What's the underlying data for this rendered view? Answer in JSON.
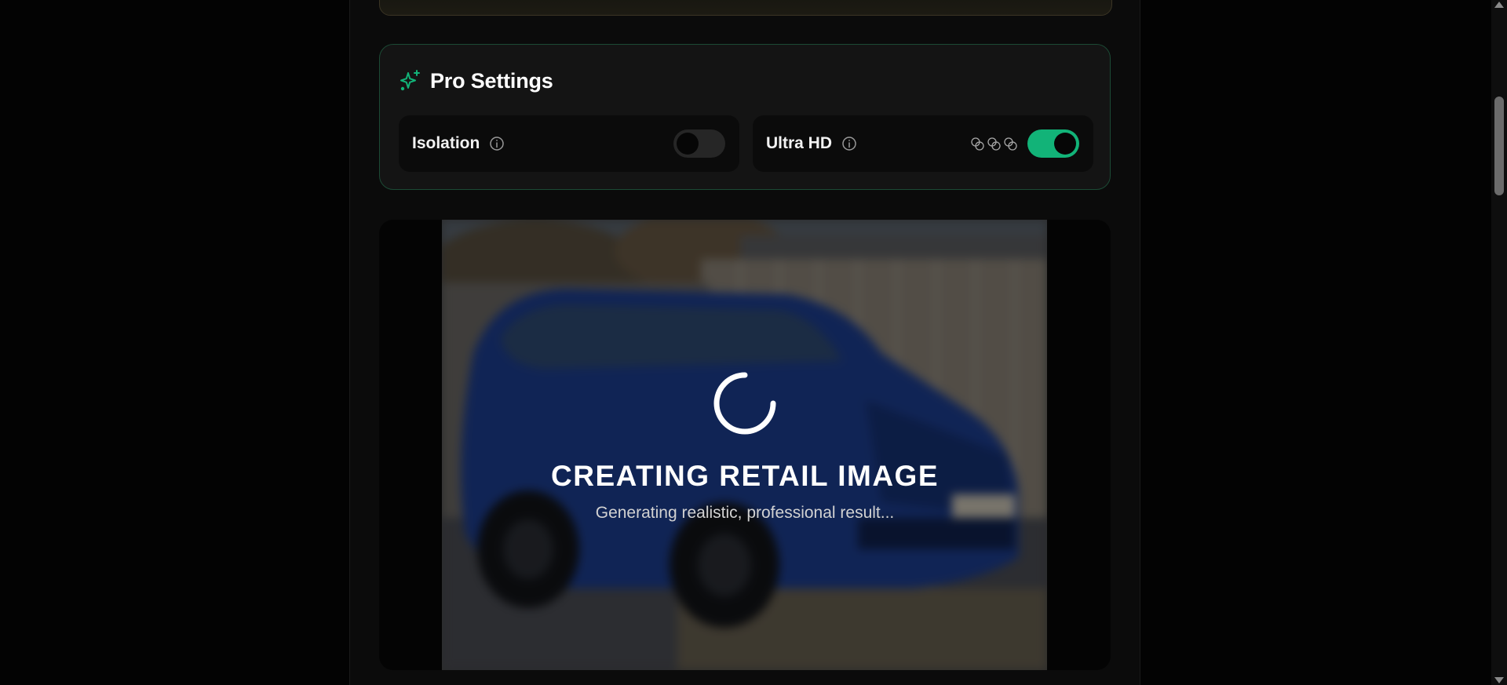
{
  "pro_settings": {
    "title": "Pro Settings",
    "icon": "sparkle-icon",
    "accent_color": "#12b378",
    "isolation": {
      "label": "Isolation",
      "enabled": false
    },
    "ultra_hd": {
      "label": "Ultra HD",
      "enabled": true,
      "credit_cost_icons": [
        "coin-icon",
        "coin-icon",
        "coin-icon"
      ]
    }
  },
  "preview": {
    "status_title": "CREATING RETAIL IMAGE",
    "status_subtitle": "Generating realistic, professional result...",
    "image_subject": "blue SUV parked in driveway (blurred)"
  }
}
